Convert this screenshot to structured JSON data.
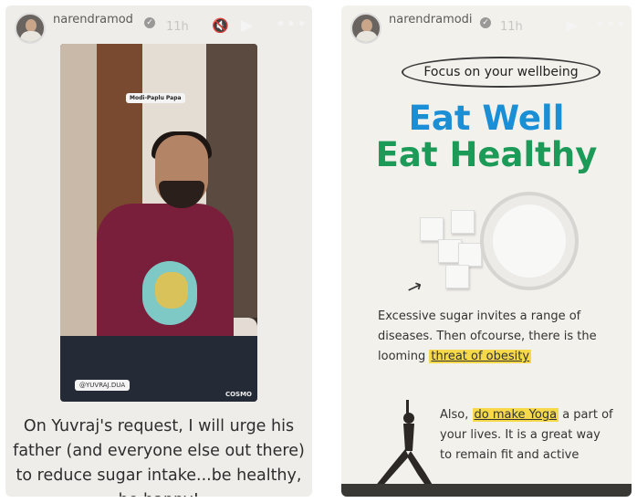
{
  "left_story": {
    "username": "narendramod",
    "time": "11h",
    "video_tag": "Modi-Paplu Papa",
    "video_handle": "@YUVRAJ.DUA",
    "watermark": "COSMO",
    "caption": "On Yuvraj's request, I will urge his father (and everyone else out there) to reduce sugar intake...be healthy, be happy!",
    "icons": [
      "mute-icon",
      "play-icon",
      "more-icon"
    ]
  },
  "right_story": {
    "username": "narendramodi",
    "time": "11h",
    "pill_text": "Focus on your wellbeing",
    "headline_1": "Eat Well",
    "headline_2": "Eat Healthy",
    "para1_pre": "Excessive sugar invites a range of diseases. Then ofcourse, there is the looming ",
    "para1_highlight": "threat of obesity",
    "para2_pre": "Also, ",
    "para2_highlight": "do make Yoga",
    "para2_post": " a part of your lives. It is a great way to remain fit and active",
    "icons": [
      "play-icon",
      "more-icon"
    ],
    "colors": {
      "well": "#1a8fd6",
      "healthy": "#1c9a58",
      "highlight": "#f5d94a"
    }
  }
}
